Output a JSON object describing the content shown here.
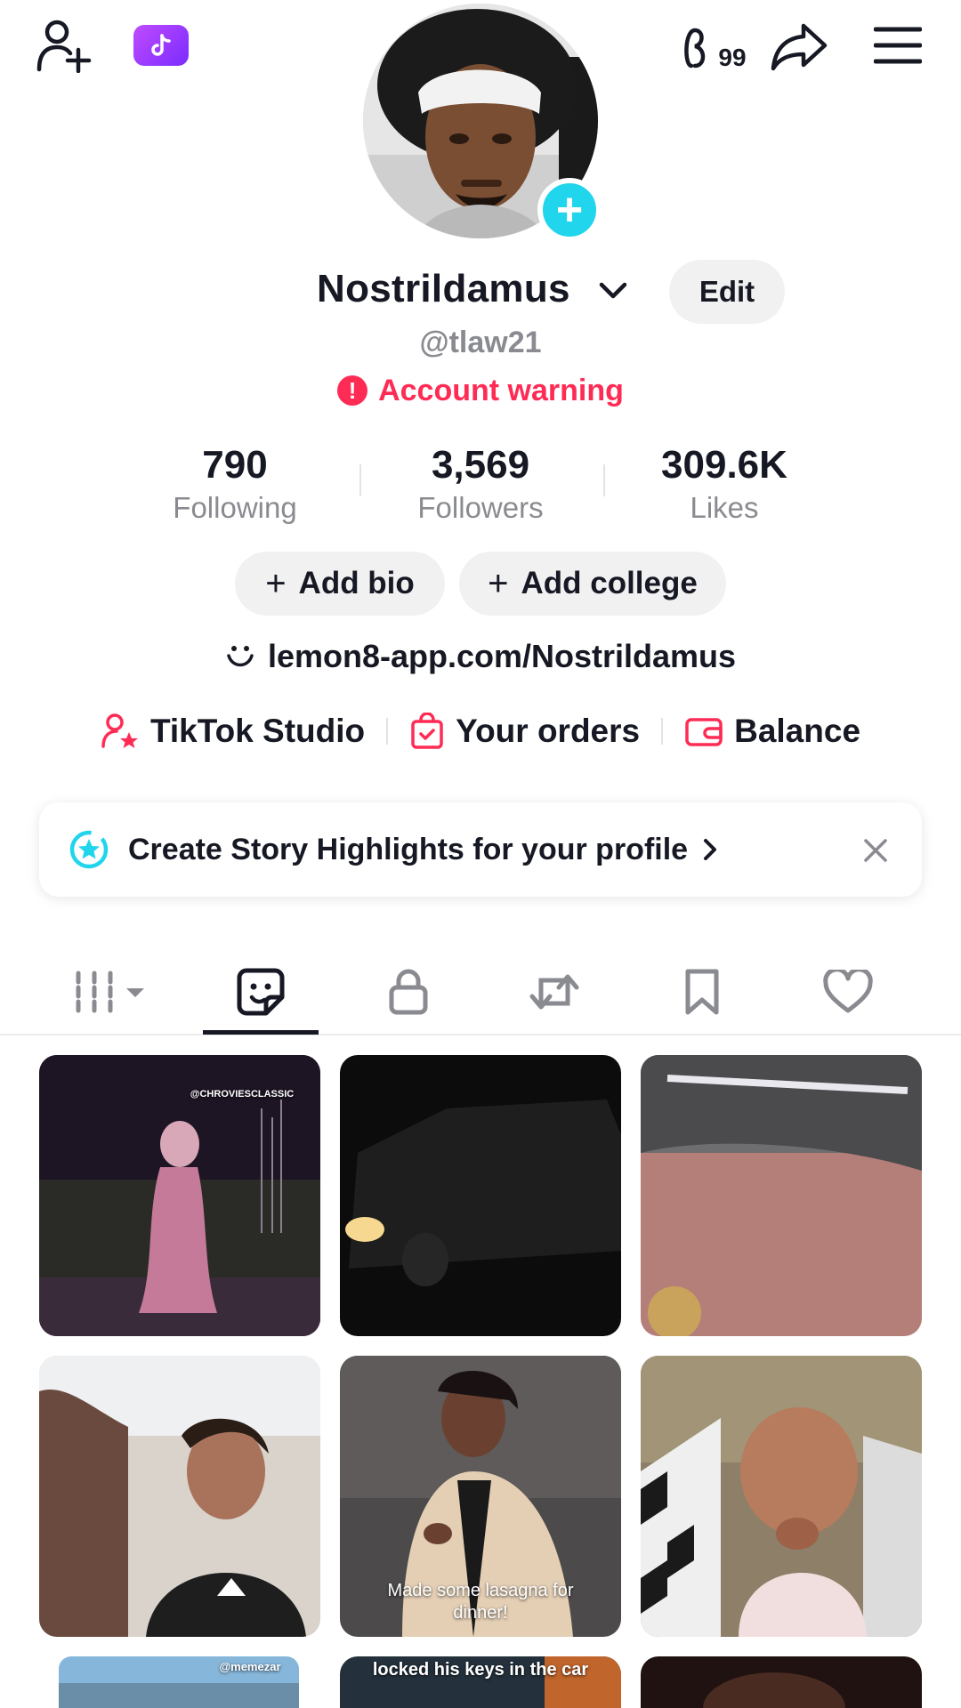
{
  "header": {
    "icons": [
      "add-friend-icon",
      "tiktok-app-icon",
      "visitors-icon",
      "share-icon",
      "menu-icon"
    ],
    "visitors_count": "99"
  },
  "profile": {
    "display_name": "Nostrildamus",
    "edit_label": "Edit",
    "handle": "@tlaw21",
    "warning": "Account warning",
    "stats": [
      {
        "value": "790",
        "label": "Following"
      },
      {
        "value": "3,569",
        "label": "Followers"
      },
      {
        "value": "309.6K",
        "label": "Likes"
      }
    ],
    "add_bio": "Add bio",
    "add_college": "Add college",
    "link": "lemon8-app.com/Nostrildamus"
  },
  "tools": [
    {
      "label": "TikTok Studio",
      "icon": "studio-icon"
    },
    {
      "label": "Your orders",
      "icon": "orders-icon"
    },
    {
      "label": "Balance",
      "icon": "wallet-icon"
    }
  ],
  "highlights_banner": {
    "text": "Create Story Highlights for your profile",
    "icon": "highlight-star-icon"
  },
  "tabs": [
    "videos-grid-tab",
    "reposts-sticker-tab",
    "private-tab",
    "repost-tab",
    "favorites-tab",
    "liked-tab"
  ],
  "active_tab": 1,
  "grid": {
    "thumb1_watermark": "@CHROVIESCLASSIC",
    "thumb5_caption": "Made some lasagna for dinner!",
    "thumb7_watermark": "@memezar",
    "thumb8_caption": "locked his keys in the car"
  },
  "colors": {
    "accent_red": "#fe2c55",
    "accent_cyan": "#20d5ec",
    "text": "#161823",
    "muted": "#8a8b91"
  }
}
